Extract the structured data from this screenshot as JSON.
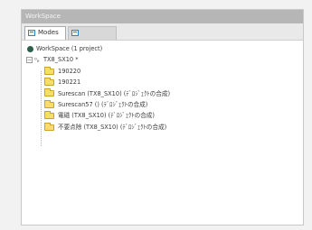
{
  "window": {
    "title": "WorkSpace"
  },
  "tabs": [
    {
      "label": "Modes",
      "icon": "modes-icon",
      "active": true
    },
    {
      "label": "",
      "icon": "tab-icon",
      "active": false
    }
  ],
  "tree": {
    "workspace_label": "WorkSpace  (1 project)",
    "project_label": "TX8_SX10 *",
    "folders": [
      "190220",
      "190221",
      "Surescan (TX8_SX10) (ﾃﾞﾛｼﾞｪｸﾄの合成)",
      "Surescan57 () (ﾃﾞﾛｼﾞｪｸﾄの合成)",
      "電磁 (TX8_SX10) (ﾃﾞﾛｼﾞｪｸﾄの合成)",
      "不要点除 (TX8_SX10) (ﾃﾞﾛｼﾞｪｸﾄの合成)"
    ]
  },
  "colors": {
    "titlebar": "#b6b6b6",
    "folder": "#f7de6a",
    "workspace_dot": "#2f5f4a"
  }
}
